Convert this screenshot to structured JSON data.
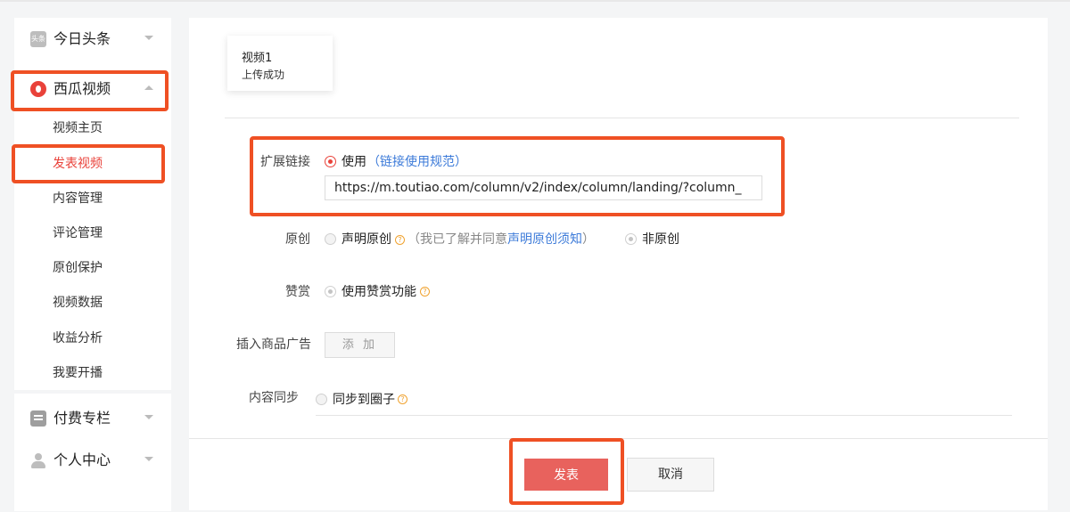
{
  "sidebar": {
    "toutiao": {
      "label": "今日头条",
      "icon_text": "头条"
    },
    "xigua": {
      "label": "西瓜视频",
      "items": [
        "视频主页",
        "发表视频",
        "内容管理",
        "评论管理",
        "原创保护",
        "视频数据",
        "收益分析",
        "我要开播"
      ],
      "active_index": 1
    },
    "paid": {
      "label": "付费专栏"
    },
    "profile": {
      "label": "个人中心"
    }
  },
  "video_card": {
    "title": "视频1",
    "status": "上传成功"
  },
  "form": {
    "ext_link": {
      "label": "扩展链接",
      "option": "使用",
      "rules_link": "（链接使用规范）",
      "url": "https://m.toutiao.com/column/v2/index/column/landing/?column_"
    },
    "original": {
      "label": "原创",
      "declare": "声明原创",
      "note_prefix": "（我已了解并同意",
      "note_link": "声明原创须知",
      "note_suffix": "）",
      "non_original": "非原创"
    },
    "reward": {
      "label": "赞赏",
      "option": "使用赞赏功能"
    },
    "ad": {
      "label": "插入商品广告",
      "button": "添 加"
    },
    "sync": {
      "label": "内容同步",
      "option": "同步到圈子"
    }
  },
  "actions": {
    "publish": "发表",
    "cancel": "取消"
  },
  "colors": {
    "accent": "#e9423a",
    "annotation": "#ef5024",
    "link": "#3d7bd9",
    "publish_bg": "#e8625d"
  }
}
